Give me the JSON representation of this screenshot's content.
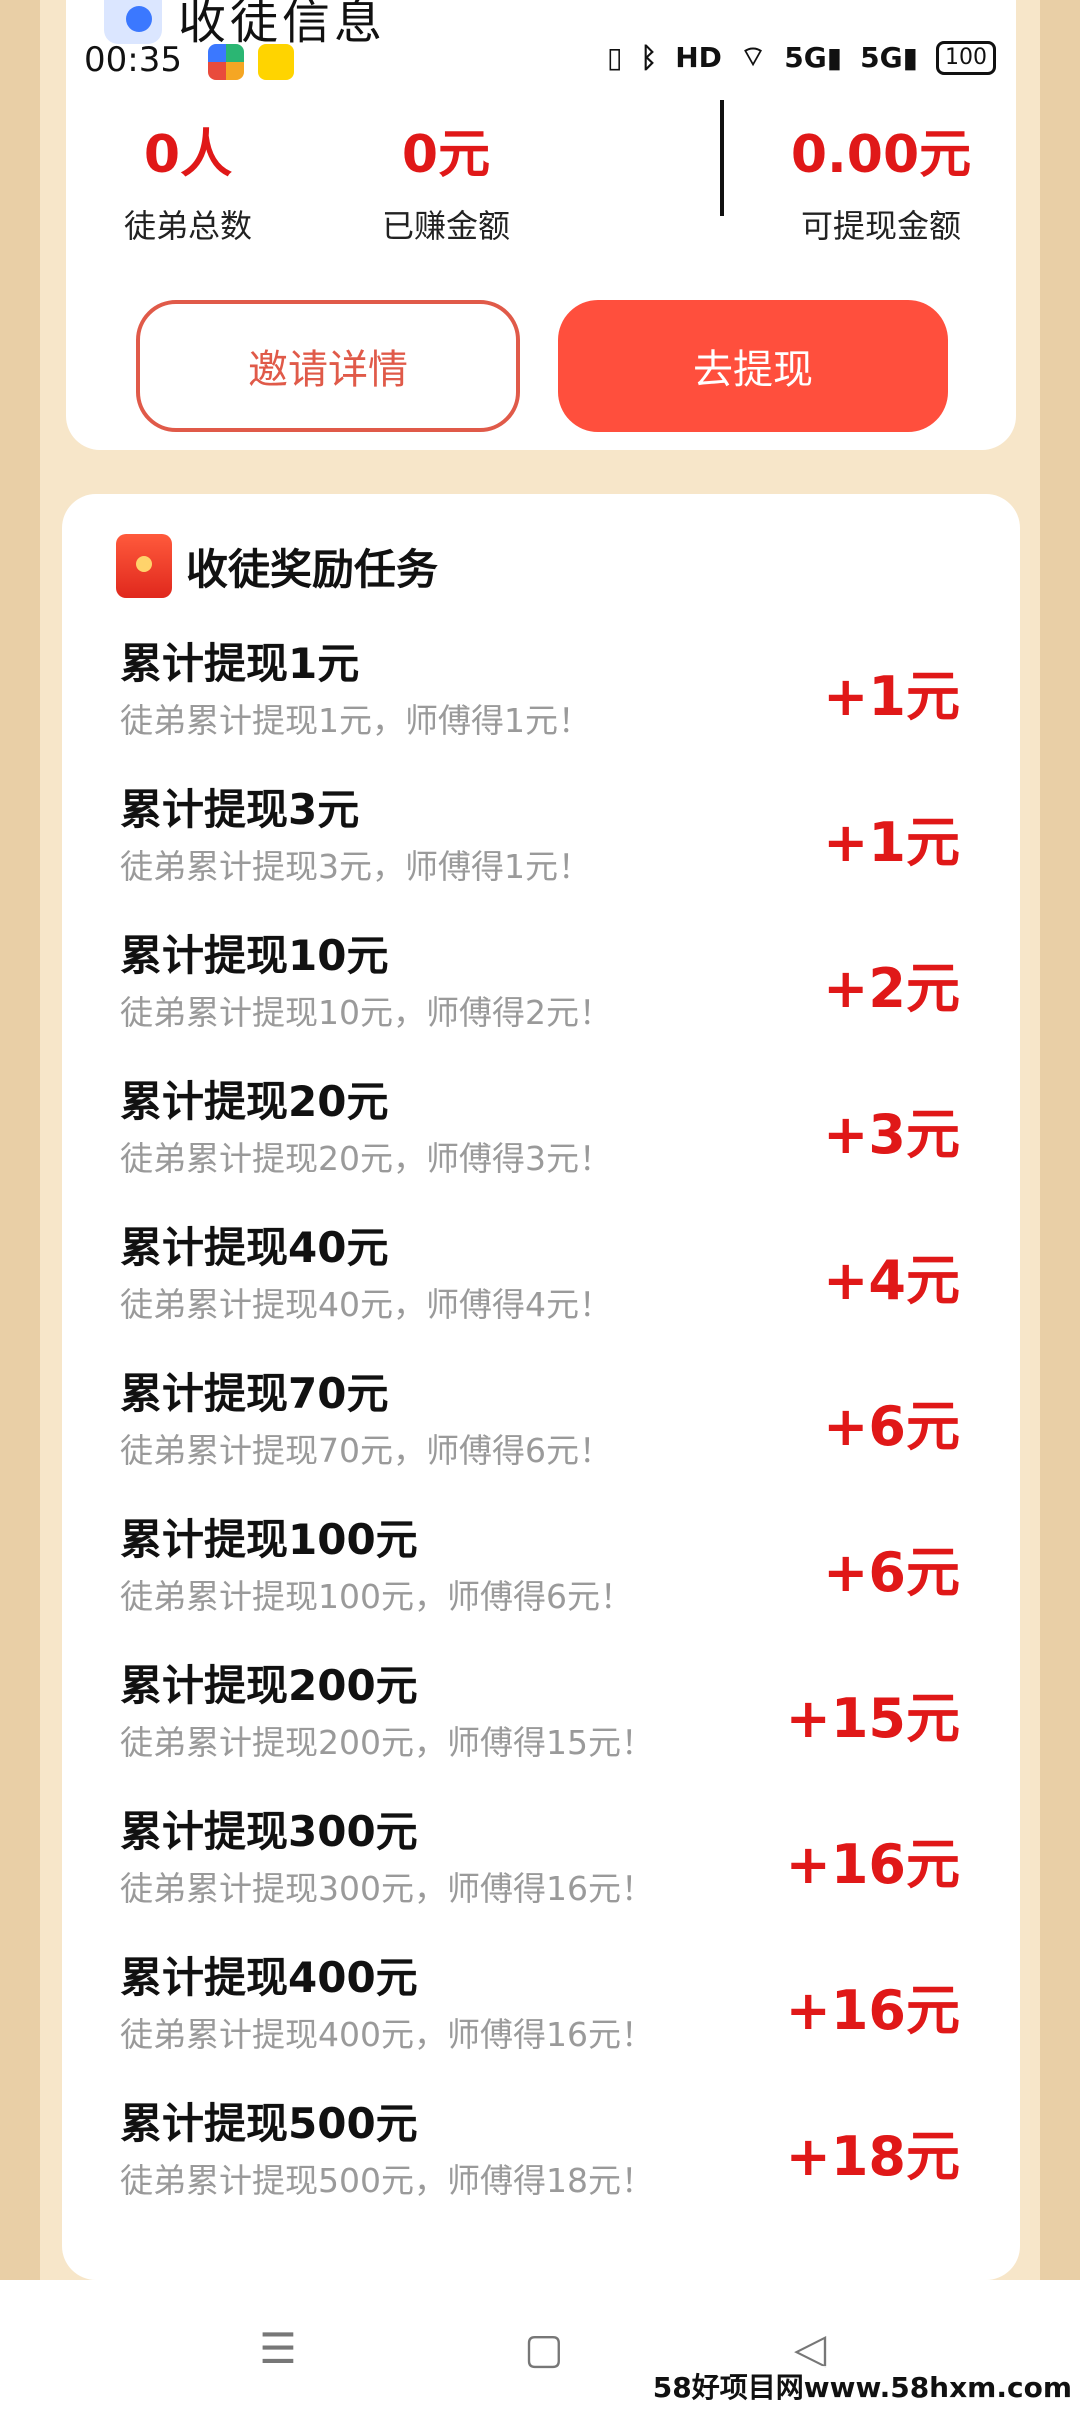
{
  "status_bar": {
    "time": "00:35",
    "icons": [
      "vibrate-icon",
      "bluetooth-icon",
      "hd-icon",
      "wifi-icon",
      "5g-signal-icon",
      "5g-signal-icon"
    ],
    "hd_label": "HD",
    "net1": "5G",
    "net2": "5G",
    "battery": "100"
  },
  "header": {
    "title": "收徒信息"
  },
  "summary": {
    "stats": [
      {
        "value": "0人",
        "label": "徒弟总数"
      },
      {
        "value": "0元",
        "label": "已赚金额"
      },
      {
        "value": "0.00元",
        "label": "可提现金额"
      }
    ],
    "invite_button": "邀请详情",
    "withdraw_button": "去提现",
    "colors": {
      "accent": "#e01818",
      "button_fill": "#ff4f3d",
      "button_outline": "#e05a49"
    }
  },
  "tasks": {
    "title": "收徒奖励任务",
    "items": [
      {
        "title": "累计提现1元",
        "desc": "徒弟累计提现1元，师傅得1元！",
        "reward": "+1元"
      },
      {
        "title": "累计提现3元",
        "desc": "徒弟累计提现3元，师傅得1元！",
        "reward": "+1元"
      },
      {
        "title": "累计提现10元",
        "desc": "徒弟累计提现10元，师傅得2元！",
        "reward": "+2元"
      },
      {
        "title": "累计提现20元",
        "desc": "徒弟累计提现20元，师傅得3元！",
        "reward": "+3元"
      },
      {
        "title": "累计提现40元",
        "desc": "徒弟累计提现40元，师傅得4元！",
        "reward": "+4元"
      },
      {
        "title": "累计提现70元",
        "desc": "徒弟累计提现70元，师傅得6元！",
        "reward": "+6元"
      },
      {
        "title": "累计提现100元",
        "desc": "徒弟累计提现100元，师傅得6元！",
        "reward": "+6元"
      },
      {
        "title": "累计提现200元",
        "desc": "徒弟累计提现200元，师傅得15元！",
        "reward": "+15元"
      },
      {
        "title": "累计提现300元",
        "desc": "徒弟累计提现300元，师傅得16元！",
        "reward": "+16元"
      },
      {
        "title": "累计提现400元",
        "desc": "徒弟累计提现400元，师傅得16元！",
        "reward": "+16元"
      },
      {
        "title": "累计提现500元",
        "desc": "徒弟累计提现500元，师傅得18元！",
        "reward": "+18元"
      }
    ]
  },
  "nav": {
    "menu_glyph": "☰",
    "home_glyph": "▢",
    "back_glyph": "◁"
  },
  "watermark": "58好项目网www.58hxm.com"
}
